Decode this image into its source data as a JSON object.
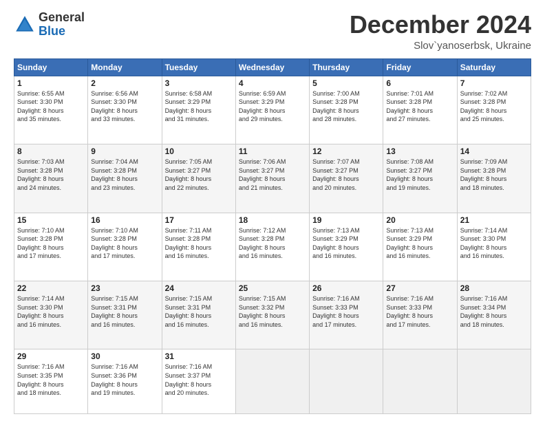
{
  "header": {
    "logo_general": "General",
    "logo_blue": "Blue",
    "title": "December 2024",
    "subtitle": "Slov`yanoserbsk, Ukraine"
  },
  "calendar": {
    "days_of_week": [
      "Sunday",
      "Monday",
      "Tuesday",
      "Wednesday",
      "Thursday",
      "Friday",
      "Saturday"
    ],
    "weeks": [
      [
        {
          "day": "",
          "info": ""
        },
        {
          "day": "2",
          "info": "Sunrise: 6:56 AM\nSunset: 3:30 PM\nDaylight: 8 hours\nand 33 minutes."
        },
        {
          "day": "3",
          "info": "Sunrise: 6:58 AM\nSunset: 3:29 PM\nDaylight: 8 hours\nand 31 minutes."
        },
        {
          "day": "4",
          "info": "Sunrise: 6:59 AM\nSunset: 3:29 PM\nDaylight: 8 hours\nand 29 minutes."
        },
        {
          "day": "5",
          "info": "Sunrise: 7:00 AM\nSunset: 3:28 PM\nDaylight: 8 hours\nand 28 minutes."
        },
        {
          "day": "6",
          "info": "Sunrise: 7:01 AM\nSunset: 3:28 PM\nDaylight: 8 hours\nand 27 minutes."
        },
        {
          "day": "7",
          "info": "Sunrise: 7:02 AM\nSunset: 3:28 PM\nDaylight: 8 hours\nand 25 minutes."
        }
      ],
      [
        {
          "day": "1",
          "info": "Sunrise: 6:55 AM\nSunset: 3:30 PM\nDaylight: 8 hours\nand 35 minutes."
        },
        {
          "day": "9",
          "info": "Sunrise: 7:04 AM\nSunset: 3:28 PM\nDaylight: 8 hours\nand 23 minutes."
        },
        {
          "day": "10",
          "info": "Sunrise: 7:05 AM\nSunset: 3:27 PM\nDaylight: 8 hours\nand 22 minutes."
        },
        {
          "day": "11",
          "info": "Sunrise: 7:06 AM\nSunset: 3:27 PM\nDaylight: 8 hours\nand 21 minutes."
        },
        {
          "day": "12",
          "info": "Sunrise: 7:07 AM\nSunset: 3:27 PM\nDaylight: 8 hours\nand 20 minutes."
        },
        {
          "day": "13",
          "info": "Sunrise: 7:08 AM\nSunset: 3:27 PM\nDaylight: 8 hours\nand 19 minutes."
        },
        {
          "day": "14",
          "info": "Sunrise: 7:09 AM\nSunset: 3:28 PM\nDaylight: 8 hours\nand 18 minutes."
        }
      ],
      [
        {
          "day": "8",
          "info": "Sunrise: 7:03 AM\nSunset: 3:28 PM\nDaylight: 8 hours\nand 24 minutes."
        },
        {
          "day": "16",
          "info": "Sunrise: 7:10 AM\nSunset: 3:28 PM\nDaylight: 8 hours\nand 17 minutes."
        },
        {
          "day": "17",
          "info": "Sunrise: 7:11 AM\nSunset: 3:28 PM\nDaylight: 8 hours\nand 16 minutes."
        },
        {
          "day": "18",
          "info": "Sunrise: 7:12 AM\nSunset: 3:28 PM\nDaylight: 8 hours\nand 16 minutes."
        },
        {
          "day": "19",
          "info": "Sunrise: 7:13 AM\nSunset: 3:29 PM\nDaylight: 8 hours\nand 16 minutes."
        },
        {
          "day": "20",
          "info": "Sunrise: 7:13 AM\nSunset: 3:29 PM\nDaylight: 8 hours\nand 16 minutes."
        },
        {
          "day": "21",
          "info": "Sunrise: 7:14 AM\nSunset: 3:30 PM\nDaylight: 8 hours\nand 16 minutes."
        }
      ],
      [
        {
          "day": "15",
          "info": "Sunrise: 7:10 AM\nSunset: 3:28 PM\nDaylight: 8 hours\nand 17 minutes."
        },
        {
          "day": "23",
          "info": "Sunrise: 7:15 AM\nSunset: 3:31 PM\nDaylight: 8 hours\nand 16 minutes."
        },
        {
          "day": "24",
          "info": "Sunrise: 7:15 AM\nSunset: 3:31 PM\nDaylight: 8 hours\nand 16 minutes."
        },
        {
          "day": "25",
          "info": "Sunrise: 7:15 AM\nSunset: 3:32 PM\nDaylight: 8 hours\nand 16 minutes."
        },
        {
          "day": "26",
          "info": "Sunrise: 7:16 AM\nSunset: 3:33 PM\nDaylight: 8 hours\nand 17 minutes."
        },
        {
          "day": "27",
          "info": "Sunrise: 7:16 AM\nSunset: 3:33 PM\nDaylight: 8 hours\nand 17 minutes."
        },
        {
          "day": "28",
          "info": "Sunrise: 7:16 AM\nSunset: 3:34 PM\nDaylight: 8 hours\nand 18 minutes."
        }
      ],
      [
        {
          "day": "22",
          "info": "Sunrise: 7:14 AM\nSunset: 3:30 PM\nDaylight: 8 hours\nand 16 minutes."
        },
        {
          "day": "30",
          "info": "Sunrise: 7:16 AM\nSunset: 3:36 PM\nDaylight: 8 hours\nand 19 minutes."
        },
        {
          "day": "31",
          "info": "Sunrise: 7:16 AM\nSunset: 3:37 PM\nDaylight: 8 hours\nand 20 minutes."
        },
        {
          "day": "",
          "info": ""
        },
        {
          "day": "29",
          "info": "Sunrise: 7:16 AM\nSunset: 3:35 PM\nDaylight: 8 hours\nand 18 minutes."
        },
        {
          "day": "",
          "info": ""
        },
        {
          "day": "",
          "info": ""
        }
      ]
    ]
  }
}
